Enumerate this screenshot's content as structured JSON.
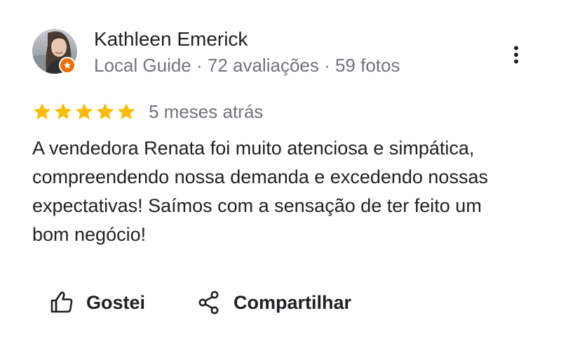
{
  "review": {
    "author": {
      "name": "Kathleen Emerick",
      "meta": "Local Guide · 72 avaliações · 59 fotos",
      "avatar_icon": "profile-photo",
      "badge_icon": "local-guide-star-badge",
      "badge_color": "#e8710a"
    },
    "rating": {
      "stars": 5,
      "max_stars": 5,
      "star_color": "#fbbc04",
      "date": "5 meses atrás"
    },
    "text_lines": [
      "A vendedora Renata foi muito atenciosa e simpática,",
      "compreendendo nossa demanda e excedendo nossas",
      "expectativas! Saímos com a sensação de ter feito um",
      "bom negócio!"
    ],
    "actions": {
      "like_label": "Gostei",
      "like_icon": "thumbs-up-icon",
      "share_label": "Compartilhar",
      "share_icon": "share-icon"
    },
    "menu_icon": "more-vert-icon"
  }
}
